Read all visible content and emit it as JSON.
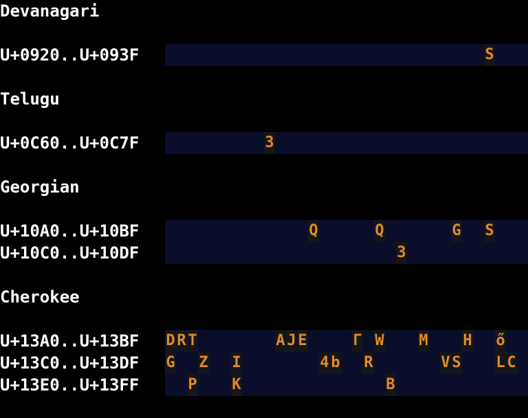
{
  "colors": {
    "background": "#000000",
    "text": "#ffffff",
    "strip": "#0a0e2a",
    "glyph": "#e08a2c",
    "cell_bg": "#15161b"
  },
  "sections": [
    {
      "title": "Devanagari",
      "rows": [
        {
          "label": "U+0920..U+093F",
          "glyphs": [
            {
              "col": 29,
              "char": "S"
            }
          ]
        }
      ]
    },
    {
      "title": "Telugu",
      "rows": [
        {
          "label": "U+0C60..U+0C7F",
          "glyphs": [
            {
              "col": 9,
              "char": "3"
            }
          ]
        }
      ]
    },
    {
      "title": "Georgian",
      "rows": [
        {
          "label": "U+10A0..U+10BF",
          "glyphs": [
            {
              "col": 13,
              "char": "Q"
            },
            {
              "col": 19,
              "char": "Q"
            },
            {
              "col": 26,
              "char": "G"
            },
            {
              "col": 29,
              "char": "S"
            }
          ]
        },
        {
          "label": "U+10C0..U+10DF",
          "glyphs": [
            {
              "col": 21,
              "char": "3"
            }
          ]
        }
      ]
    },
    {
      "title": "Cherokee",
      "rows": [
        {
          "label": "U+13A0..U+13BF",
          "glyphs": [
            {
              "col": 0,
              "char": "D"
            },
            {
              "col": 1,
              "char": "R"
            },
            {
              "col": 2,
              "char": "T"
            },
            {
              "col": 10,
              "char": "A"
            },
            {
              "col": 11,
              "char": "J"
            },
            {
              "col": 12,
              "char": "E"
            },
            {
              "col": 17,
              "char": "Γ"
            },
            {
              "col": 19,
              "char": "W"
            },
            {
              "col": 23,
              "char": "M"
            },
            {
              "col": 27,
              "char": "H"
            },
            {
              "col": 30,
              "char": "ő"
            }
          ]
        },
        {
          "label": "U+13C0..U+13DF",
          "glyphs": [
            {
              "col": 0,
              "char": "G"
            },
            {
              "col": 3,
              "char": "Z"
            },
            {
              "col": 6,
              "char": "I"
            },
            {
              "col": 14,
              "char": "4"
            },
            {
              "col": 15,
              "char": "b"
            },
            {
              "col": 18,
              "char": "R"
            },
            {
              "col": 25,
              "char": "V"
            },
            {
              "col": 26,
              "char": "S"
            },
            {
              "col": 30,
              "char": "L"
            },
            {
              "col": 31,
              "char": "C"
            }
          ]
        },
        {
          "label": "U+13E0..U+13FF",
          "glyphs": [
            {
              "col": 2,
              "char": "P"
            },
            {
              "col": 6,
              "char": "K"
            },
            {
              "col": 20,
              "char": "B"
            }
          ]
        }
      ]
    }
  ]
}
